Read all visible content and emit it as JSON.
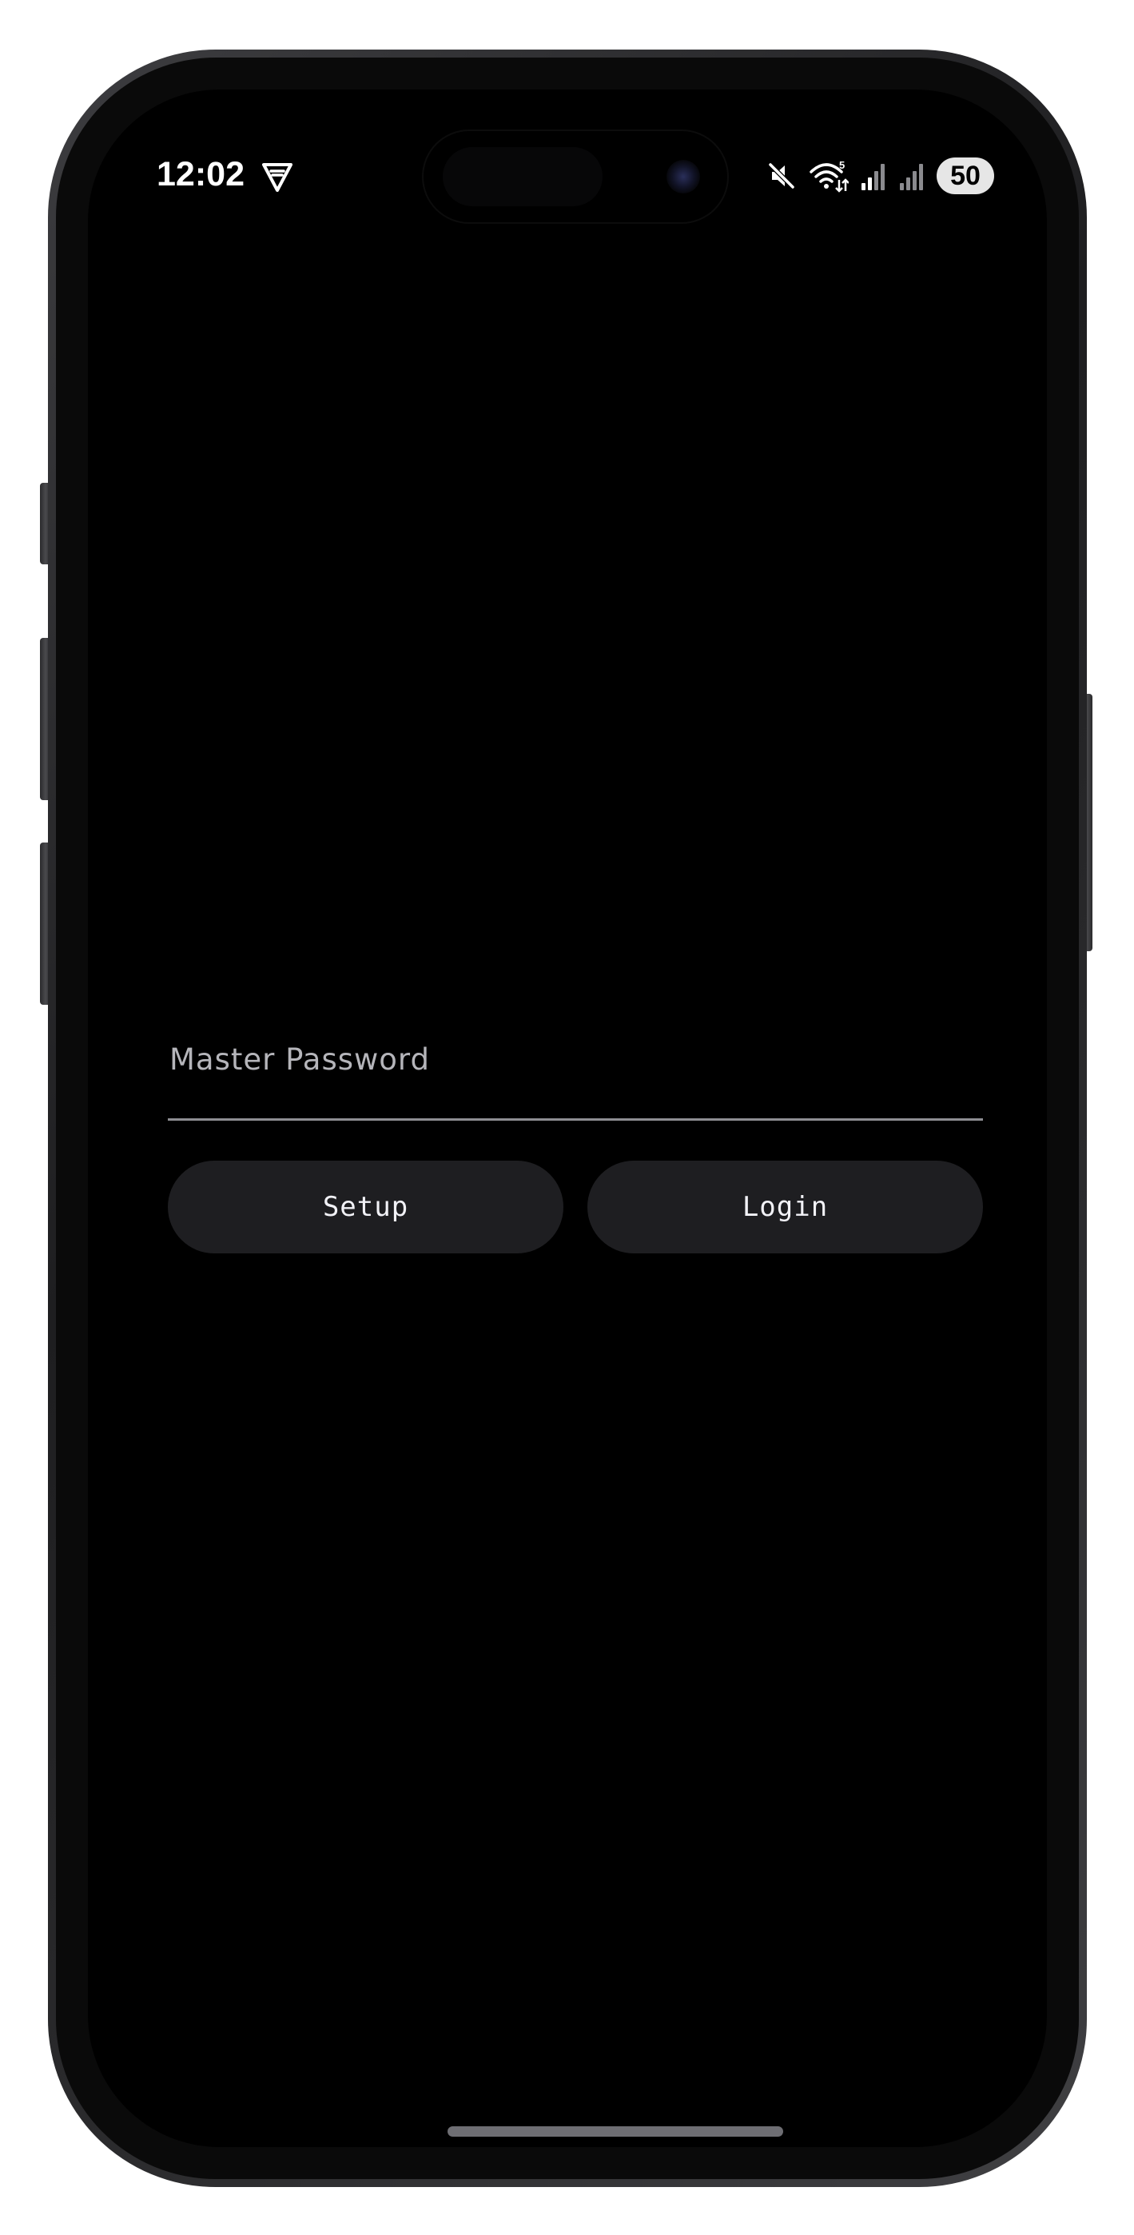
{
  "status_bar": {
    "time": "12:02",
    "icons": [
      "vpn-shield-icon",
      "mute-icon",
      "wifi-icon",
      "cell-signal-icon",
      "cell-signal-secondary-icon"
    ],
    "wifi_badge": "5",
    "battery": "50"
  },
  "login": {
    "password_placeholder": "Master Password",
    "setup_label": "Setup",
    "login_label": "Login"
  },
  "colors": {
    "background": "#000000",
    "button_bg": "#1e1e21",
    "underline": "#8e8e93",
    "placeholder": "#b5b5ba"
  }
}
